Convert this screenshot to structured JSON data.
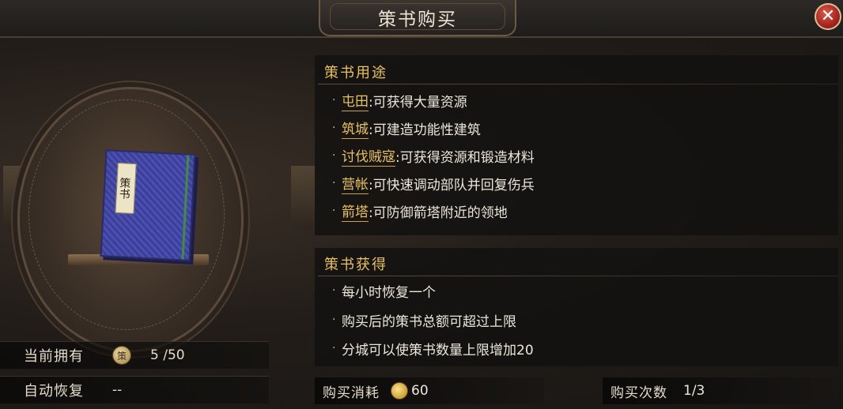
{
  "window": {
    "title": "策书购买",
    "close_symbol": "✕"
  },
  "item": {
    "book_label": "策书",
    "coin_char": "策"
  },
  "stats": {
    "owned_label": "当前拥有",
    "owned_value": "5 /50",
    "recover_label": "自动恢复",
    "recover_value": "--"
  },
  "uses": {
    "title": "策书用途",
    "items": [
      {
        "keyword": "屯田",
        "text": ":可获得大量资源"
      },
      {
        "keyword": "筑城",
        "text": ":可建造功能性建筑"
      },
      {
        "keyword": "讨伐贼寇",
        "text": ":可获得资源和锻造材料"
      },
      {
        "keyword": "营帐",
        "text": ":可快速调动部队并回复伤兵"
      },
      {
        "keyword": "箭塔",
        "text": ":可防御箭塔附近的领地"
      }
    ]
  },
  "obtain": {
    "title": "策书获得",
    "items": [
      "每小时恢复一个",
      "购买后的策书总额可超过上限",
      "分城可以使策书数量上限增加20"
    ]
  },
  "purchase": {
    "cost_label": "购买消耗",
    "cost_value": "60",
    "count_label": "购买次数",
    "count_value": "1/3"
  },
  "icons": {
    "close": "close-icon",
    "coin": "gold-coin-icon",
    "book": "strategy-book-icon"
  }
}
